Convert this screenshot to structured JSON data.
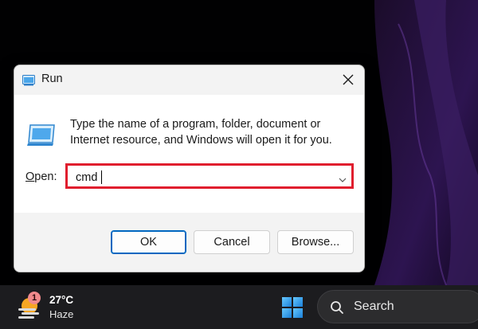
{
  "desktop": {
    "wallpaper": "dark-purple-abstract"
  },
  "dialog": {
    "title": "Run",
    "description": "Type the name of a program, folder, document or Internet resource, and Windows will open it for you.",
    "open_label_mnemonic": "O",
    "open_label_rest": "pen:",
    "open_value": "cmd",
    "buttons": {
      "ok": "OK",
      "cancel": "Cancel",
      "browse": "Browse..."
    },
    "icons": {
      "title": "run-icon",
      "program": "run-program-icon",
      "close": "close-icon",
      "dropdown": "chevron-down-icon"
    },
    "highlight_color": "#e01e2e"
  },
  "taskbar": {
    "weather": {
      "badge": "1",
      "temp": "27°C",
      "condition": "Haze",
      "icon": "sun-haze-icon"
    },
    "start_icon": "windows-logo-icon",
    "search": {
      "label": "Search",
      "icon": "search-icon"
    }
  }
}
